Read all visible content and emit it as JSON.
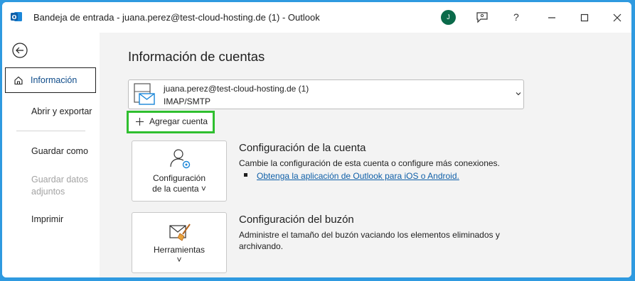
{
  "window": {
    "title": "Bandeja de entrada - juana.perez@test-cloud-hosting.de (1)  -  Outlook",
    "avatar_initial": "J",
    "help_label": "?",
    "app_icon": "outlook-icon",
    "accent_color": "#2fbf2f",
    "link_color": "#0f5fa8"
  },
  "nav": {
    "back_icon": "back-arrow-icon",
    "items": [
      {
        "label": "Información",
        "selected": true,
        "icon": "home-icon"
      },
      {
        "label": "Abrir y exportar"
      },
      {
        "label": "Guardar como"
      },
      {
        "label": "Guardar datos adjuntos",
        "disabled": true
      },
      {
        "label": "Imprimir"
      }
    ]
  },
  "main": {
    "title": "Información de cuentas",
    "account": {
      "email": "juana.perez@test-cloud-hosting.de (1)",
      "type": "IMAP/SMTP"
    },
    "add_account_label": "Agregar cuenta",
    "sections": [
      {
        "button_label_line1": "Configuración",
        "button_label_line2": "de la cuenta ˅",
        "title": "Configuración de la cuenta",
        "description": "Cambie la configuración de esta cuenta o configure más conexiones.",
        "link": "Obtenga la aplicación de Outlook para iOS o Android."
      },
      {
        "button_label_line1": "Herramientas",
        "button_label_line2": "˅",
        "title": "Configuración del buzón",
        "description": "Administre el tamaño del buzón vaciando los elementos eliminados y archivando."
      }
    ]
  }
}
